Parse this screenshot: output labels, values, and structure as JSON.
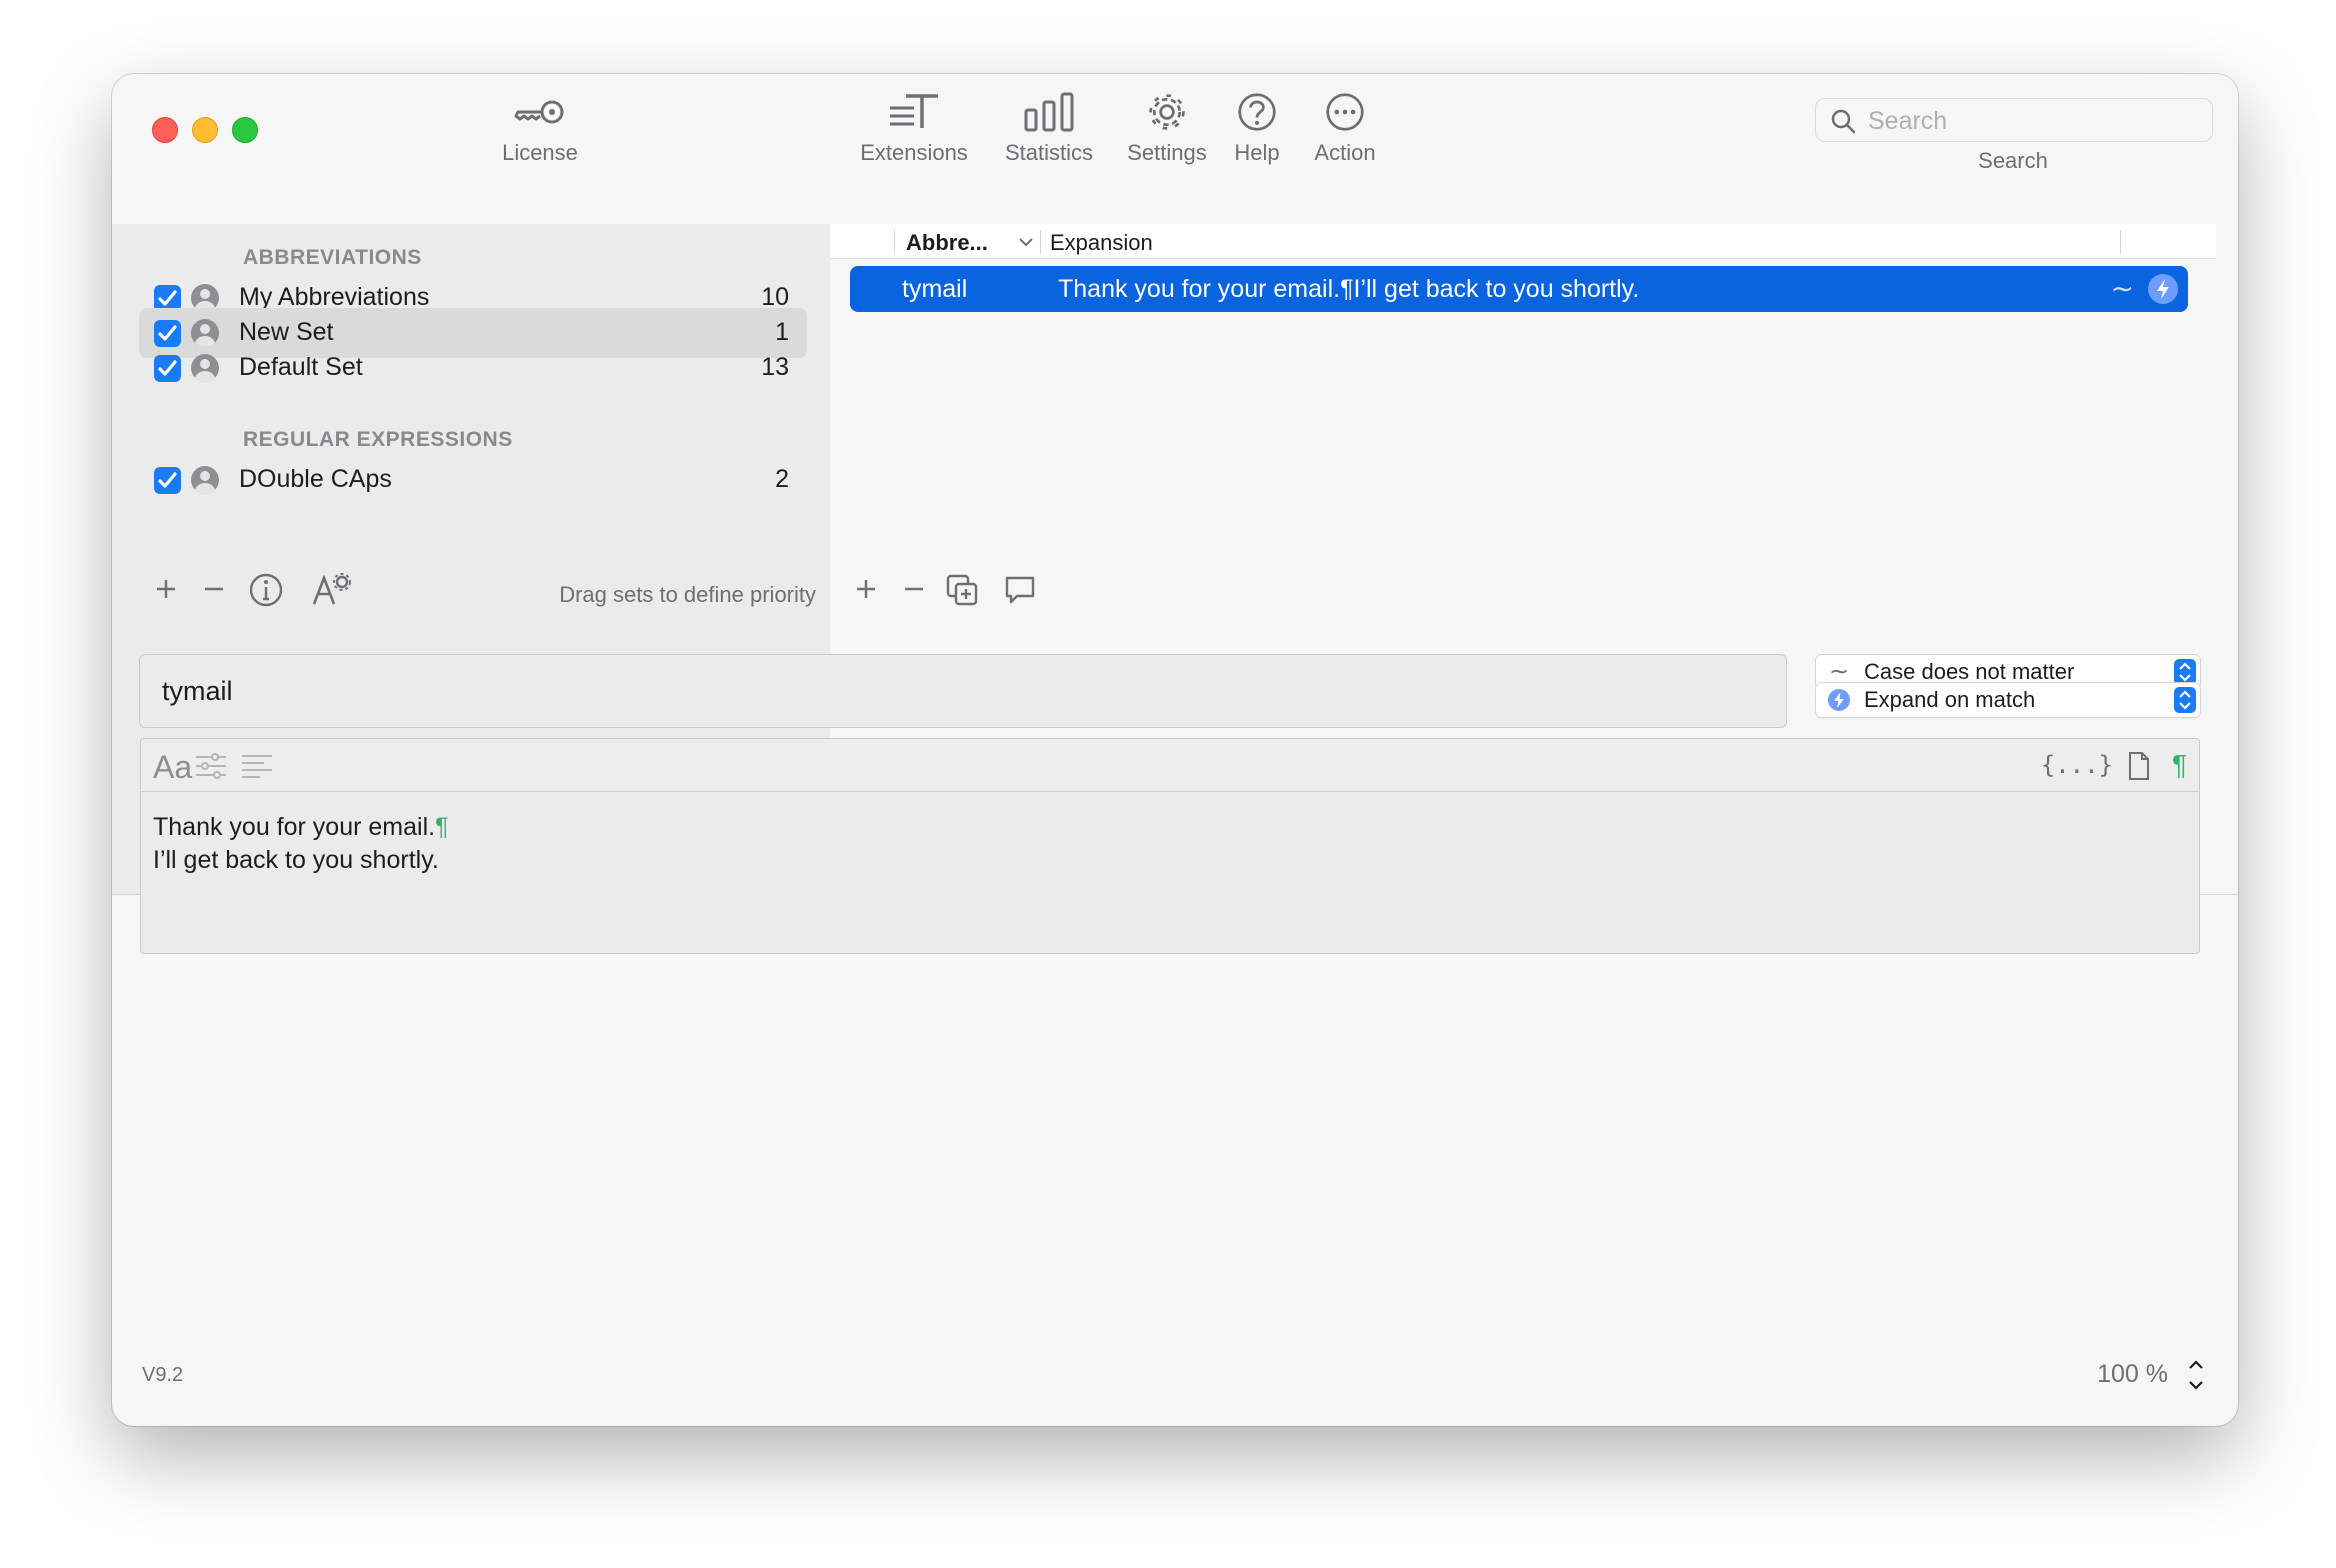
{
  "window": {
    "traffic_lights": {
      "red": "#fe5f57",
      "yellow": "#febc2e",
      "green": "#28c840"
    }
  },
  "toolbar": {
    "items": [
      {
        "label": "License",
        "icon": "key-icon"
      },
      {
        "label": "Extensions",
        "icon": "text-extensions-icon"
      },
      {
        "label": "Statistics",
        "icon": "bar-chart-icon"
      },
      {
        "label": "Settings",
        "icon": "gear-icon"
      },
      {
        "label": "Help",
        "icon": "question-icon"
      },
      {
        "label": "Action",
        "icon": "ellipsis-icon"
      }
    ],
    "search": {
      "placeholder": "Search",
      "label": "Search"
    }
  },
  "sidebar": {
    "abbreviations_heading": "ABBREVIATIONS",
    "regex_heading": "REGULAR EXPRESSIONS",
    "abbreviation_sets": [
      {
        "name": "My Abbreviations",
        "count": "10",
        "checked": true,
        "selected": false
      },
      {
        "name": "New Set",
        "count": "1",
        "checked": true,
        "selected": true
      },
      {
        "name": "Default Set",
        "count": "13",
        "checked": true,
        "selected": false
      }
    ],
    "regex_sets": [
      {
        "name": "DOuble CAps",
        "count": "2",
        "checked": true
      }
    ],
    "footer_hint": "Drag sets to define priority"
  },
  "list": {
    "columns": {
      "abbreviation": "Abbre...",
      "expansion": "Expansion"
    },
    "rows": [
      {
        "abbreviation": "tymail",
        "expansion": "Thank you for your email.¶I’ll get back to you shortly.",
        "selected": true
      }
    ]
  },
  "editor": {
    "abbreviation_value": "tymail",
    "case_option": "Case does not matter",
    "expand_option": "Expand on match",
    "format_label": "Aa",
    "placeholder_icon_label": "{...}",
    "expansion_lines": [
      "Thank you for your email.",
      "I’ll get back to you shortly."
    ]
  },
  "status": {
    "version": "V9.2",
    "zoom": "100 %"
  },
  "colors": {
    "accent": "#1a7bf6",
    "selection": "#0a64e0",
    "pilcrow": "#2fb36a"
  }
}
